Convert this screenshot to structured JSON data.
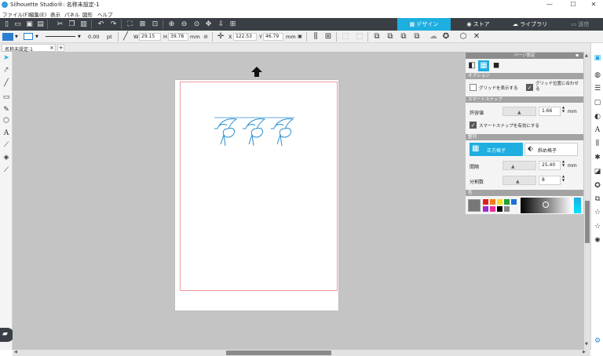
{
  "app": {
    "title": "Silhouette Studio®: 名称未設定-1"
  },
  "window_controls": {
    "minimize": "—",
    "maximize": "☐",
    "close": "✕"
  },
  "menu": [
    "ファイル(F)",
    "編集(E)",
    "表示",
    "パネル",
    "図形",
    "ヘルプ"
  ],
  "tabs": {
    "design": "デザイン",
    "store": "ストア",
    "library": "ライブラリ",
    "send": "送信"
  },
  "line_settings": {
    "width": "0.00",
    "unit": "pt"
  },
  "dimensions": {
    "w_label": "W",
    "w": "29.15",
    "h_label": "H",
    "h": "39.78",
    "unit": "mm",
    "x_label": "X",
    "x": "122.53",
    "y_label": "Y",
    "y": "46.79",
    "unit2": "mm"
  },
  "doc_tab": {
    "name": "名称未設定-1",
    "close": "×",
    "add": "+"
  },
  "page_panel": {
    "title": "ページ設定",
    "options_header": "オプション",
    "show_grid": "グリッドを表示する",
    "snap_to_grid": "グリッド位置に合わせる",
    "smart_snap_header": "スマートスナップ",
    "tolerance_label": "許容値",
    "tolerance_value": "1.66",
    "tolerance_unit": "mm",
    "enable_smart_snap": "スマートスナップを有効にする",
    "grid_header": "整列",
    "square_grid": "正方格子",
    "diagonal_grid": "斜め格子",
    "spacing_label": "間隔",
    "spacing_value": "25.40",
    "spacing_unit": "mm",
    "divisions_label": "分割数",
    "divisions_value": "8",
    "color_header": "色"
  },
  "colors": {
    "accent": "#1eaee0",
    "toolbar_dark": "#3a3f45",
    "canvas": "#c4c4c4",
    "cut_border": "#f09a9a",
    "design_blue": "#2a8fd0",
    "swatches": [
      "#e02020",
      "#f07b1c",
      "#f4e11b",
      "#1aa337",
      "#1f6fd8",
      "#9a2ad0",
      "#e8309a",
      "#000000",
      "#888888"
    ]
  }
}
